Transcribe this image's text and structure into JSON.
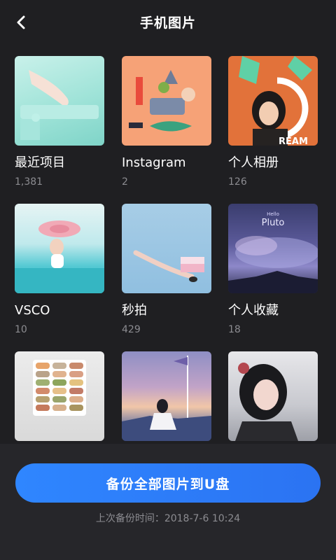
{
  "header": {
    "title": "手机图片",
    "back_icon": "chevron-left-icon"
  },
  "albums": [
    {
      "name": "最近项目",
      "count": "1,381"
    },
    {
      "name": "Instagram",
      "count": "2"
    },
    {
      "name": "个人相册",
      "count": "126"
    },
    {
      "name": "VSCO",
      "count": "10"
    },
    {
      "name": "秒拍",
      "count": "429"
    },
    {
      "name": "个人收藏",
      "count": "18"
    },
    {
      "name": "",
      "count": ""
    },
    {
      "name": "",
      "count": ""
    },
    {
      "name": "",
      "count": ""
    }
  ],
  "thumb_texts": {
    "album3": "REAM",
    "album6_small": "Hello",
    "album6_title": "Pluto"
  },
  "footer": {
    "button_label": "备份全部图片到U盘",
    "last_backup": "上次备份时间：2018-7-6   10:24"
  },
  "colors": {
    "background": "#1f1f22",
    "footer_bg": "#26262a",
    "accent": "#2f86ff",
    "secondary_text": "#8c8c91"
  }
}
